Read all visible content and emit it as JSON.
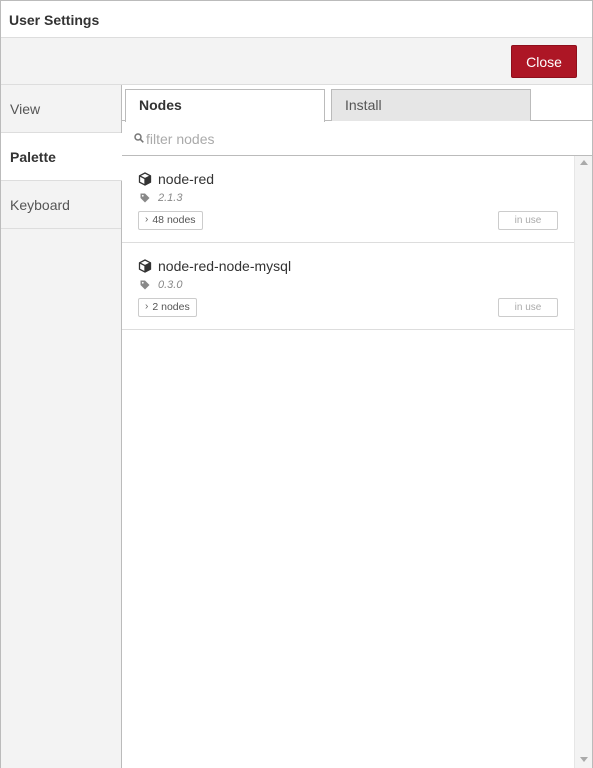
{
  "dialog": {
    "title": "User Settings"
  },
  "buttons": {
    "close_label": "Close"
  },
  "sidebar": {
    "items": [
      {
        "label": "View",
        "selected": false
      },
      {
        "label": "Palette",
        "selected": true
      },
      {
        "label": "Keyboard",
        "selected": false
      }
    ]
  },
  "palette": {
    "tabs": [
      {
        "label": "Nodes",
        "active": true
      },
      {
        "label": "Install",
        "active": false
      }
    ],
    "filter": {
      "placeholder": "filter nodes",
      "value": ""
    },
    "nodes": [
      {
        "name": "node-red",
        "version": "2.1.3",
        "count_label": "48 nodes",
        "status_label": "in use"
      },
      {
        "name": "node-red-node-mysql",
        "version": "0.3.0",
        "count_label": "2 nodes",
        "status_label": "in use"
      }
    ]
  },
  "icons": {
    "package": "cube-icon",
    "version": "tag-icon",
    "search": "search-icon",
    "expand": "chevron-right-icon"
  },
  "colors": {
    "close_button": "#ad1625",
    "sidebar_background": "#f3f3f3",
    "inactive_tab": "#e6e6e6"
  }
}
